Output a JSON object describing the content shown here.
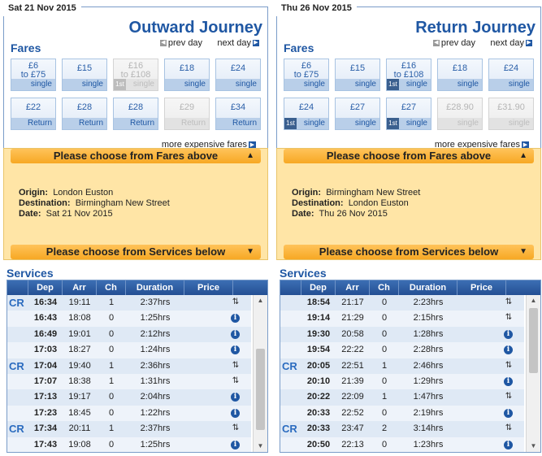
{
  "outward": {
    "date": "Sat 21 Nov 2015",
    "title": "Outward Journey",
    "prev_day": "prev day",
    "next_day": "next day",
    "fares_heading": "Fares",
    "fares_row1": [
      {
        "line1": "£6",
        "line2": "to £75",
        "type": "single",
        "disabled": false,
        "first": false
      },
      {
        "line1": "£15",
        "line2": "",
        "type": "single",
        "disabled": false,
        "first": false
      },
      {
        "line1": "£16",
        "line2": "to £108",
        "type": "single",
        "disabled": true,
        "first": true
      },
      {
        "line1": "£18",
        "line2": "",
        "type": "single",
        "disabled": false,
        "first": false
      },
      {
        "line1": "£24",
        "line2": "",
        "type": "single",
        "disabled": false,
        "first": false
      }
    ],
    "fares_row2": [
      {
        "line1": "£22",
        "line2": "",
        "type": "Return",
        "disabled": false,
        "first": false
      },
      {
        "line1": "£28",
        "line2": "",
        "type": "Return",
        "disabled": false,
        "first": false
      },
      {
        "line1": "£28",
        "line2": "",
        "type": "Return",
        "disabled": false,
        "first": false
      },
      {
        "line1": "£29",
        "line2": "",
        "type": "Return",
        "disabled": true,
        "first": false
      },
      {
        "line1": "£34",
        "line2": "",
        "type": "Return",
        "disabled": false,
        "first": false
      }
    ],
    "more_fares": "more expensive fares",
    "choose_fares": "Please choose from Fares above",
    "choose_services": "Please choose from Services below",
    "origin_label": "Origin:",
    "origin": "London Euston",
    "destination_label": "Destination:",
    "destination": "Birmingham New Street",
    "date_label": "Date:",
    "travel_date": "Sat 21 Nov 2015",
    "services_heading": "Services",
    "columns": [
      "Dep",
      "Arr",
      "Ch",
      "Duration",
      "Price"
    ],
    "services": [
      {
        "cr": true,
        "dep": "16:34",
        "arr": "19:11",
        "ch": "1",
        "dur": "2:37hrs",
        "icon": "change-icon"
      },
      {
        "cr": false,
        "dep": "16:43",
        "arr": "18:08",
        "ch": "0",
        "dur": "1:25hrs",
        "icon": "info-icon"
      },
      {
        "cr": false,
        "dep": "16:49",
        "arr": "19:01",
        "ch": "0",
        "dur": "2:12hrs",
        "icon": "info-icon"
      },
      {
        "cr": false,
        "dep": "17:03",
        "arr": "18:27",
        "ch": "0",
        "dur": "1:24hrs",
        "icon": "info-icon"
      },
      {
        "cr": true,
        "dep": "17:04",
        "arr": "19:40",
        "ch": "1",
        "dur": "2:36hrs",
        "icon": "change-icon"
      },
      {
        "cr": false,
        "dep": "17:07",
        "arr": "18:38",
        "ch": "1",
        "dur": "1:31hrs",
        "icon": "change-icon"
      },
      {
        "cr": false,
        "dep": "17:13",
        "arr": "19:17",
        "ch": "0",
        "dur": "2:04hrs",
        "icon": "info-icon"
      },
      {
        "cr": false,
        "dep": "17:23",
        "arr": "18:45",
        "ch": "0",
        "dur": "1:22hrs",
        "icon": "info-icon"
      },
      {
        "cr": true,
        "dep": "17:34",
        "arr": "20:11",
        "ch": "1",
        "dur": "2:37hrs",
        "icon": "change-icon"
      },
      {
        "cr": false,
        "dep": "17:43",
        "arr": "19:08",
        "ch": "0",
        "dur": "1:25hrs",
        "icon": "info-icon"
      }
    ]
  },
  "return": {
    "date": "Thu 26 Nov 2015",
    "title": "Return Journey",
    "prev_day": "prev day",
    "next_day": "next day",
    "fares_heading": "Fares",
    "fares_row1": [
      {
        "line1": "£6",
        "line2": "to £75",
        "type": "single",
        "disabled": false,
        "first": false
      },
      {
        "line1": "£15",
        "line2": "",
        "type": "single",
        "disabled": false,
        "first": false
      },
      {
        "line1": "£16",
        "line2": "to £108",
        "type": "single",
        "disabled": false,
        "first": true
      },
      {
        "line1": "£18",
        "line2": "",
        "type": "single",
        "disabled": false,
        "first": false
      },
      {
        "line1": "£24",
        "line2": "",
        "type": "single",
        "disabled": false,
        "first": false
      }
    ],
    "fares_row2": [
      {
        "line1": "£24",
        "line2": "",
        "type": "single",
        "disabled": false,
        "first": true
      },
      {
        "line1": "£27",
        "line2": "",
        "type": "single",
        "disabled": false,
        "first": false
      },
      {
        "line1": "£27",
        "line2": "",
        "type": "single",
        "disabled": false,
        "first": true
      },
      {
        "line1": "£28.90",
        "line2": "",
        "type": "single",
        "disabled": true,
        "first": false
      },
      {
        "line1": "£31.90",
        "line2": "",
        "type": "single",
        "disabled": true,
        "first": false
      }
    ],
    "more_fares": "more expensive fares",
    "choose_fares": "Please choose from Fares above",
    "choose_services": "Please choose from Services below",
    "origin_label": "Origin:",
    "origin": "Birmingham New Street",
    "destination_label": "Destination:",
    "destination": "London Euston",
    "date_label": "Date:",
    "travel_date": "Thu 26 Nov 2015",
    "services_heading": "Services",
    "columns": [
      "Dep",
      "Arr",
      "Ch",
      "Duration",
      "Price"
    ],
    "services": [
      {
        "cr": false,
        "dep": "18:54",
        "arr": "21:17",
        "ch": "0",
        "dur": "2:23hrs",
        "icon": "change-icon"
      },
      {
        "cr": false,
        "dep": "19:14",
        "arr": "21:29",
        "ch": "0",
        "dur": "2:15hrs",
        "icon": "change-icon"
      },
      {
        "cr": false,
        "dep": "19:30",
        "arr": "20:58",
        "ch": "0",
        "dur": "1:28hrs",
        "icon": "info-icon"
      },
      {
        "cr": false,
        "dep": "19:54",
        "arr": "22:22",
        "ch": "0",
        "dur": "2:28hrs",
        "icon": "info-icon"
      },
      {
        "cr": true,
        "dep": "20:05",
        "arr": "22:51",
        "ch": "1",
        "dur": "2:46hrs",
        "icon": "change-icon"
      },
      {
        "cr": false,
        "dep": "20:10",
        "arr": "21:39",
        "ch": "0",
        "dur": "1:29hrs",
        "icon": "info-icon"
      },
      {
        "cr": false,
        "dep": "20:22",
        "arr": "22:09",
        "ch": "1",
        "dur": "1:47hrs",
        "icon": "change-icon"
      },
      {
        "cr": false,
        "dep": "20:33",
        "arr": "22:52",
        "ch": "0",
        "dur": "2:19hrs",
        "icon": "info-icon"
      },
      {
        "cr": true,
        "dep": "20:33",
        "arr": "23:47",
        "ch": "2",
        "dur": "3:14hrs",
        "icon": "change-icon"
      },
      {
        "cr": false,
        "dep": "20:50",
        "arr": "22:13",
        "ch": "0",
        "dur": "1:23hrs",
        "icon": "info-icon"
      }
    ]
  },
  "labels": {
    "cr": "CR",
    "first_class": "1st"
  },
  "colors": {
    "accent": "#1f57a3",
    "info_bg": "#ffe5a6",
    "bar": "#f7a823"
  }
}
